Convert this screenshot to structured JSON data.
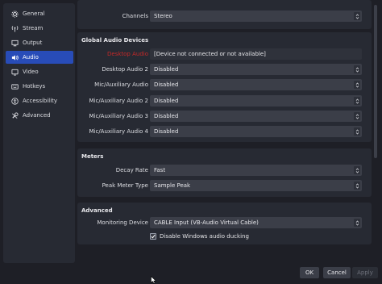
{
  "sidebar": {
    "items": [
      {
        "label": "General",
        "icon": "gear-icon",
        "active": false
      },
      {
        "label": "Stream",
        "icon": "antenna-icon",
        "active": false
      },
      {
        "label": "Output",
        "icon": "output-icon",
        "active": false
      },
      {
        "label": "Audio",
        "icon": "speaker-icon",
        "active": true
      },
      {
        "label": "Video",
        "icon": "monitor-icon",
        "active": false
      },
      {
        "label": "Hotkeys",
        "icon": "keyboard-icon",
        "active": false
      },
      {
        "label": "Accessibility",
        "icon": "accessibility-icon",
        "active": false
      },
      {
        "label": "Advanced",
        "icon": "wrench-icon",
        "active": false
      }
    ]
  },
  "top": {
    "channels_label": "Channels",
    "channels_value": "Stereo"
  },
  "global_audio": {
    "title": "Global Audio Devices",
    "rows": [
      {
        "label": "Desktop Audio",
        "value": "[Device not connected or not available]",
        "warn": true
      },
      {
        "label": "Desktop Audio 2",
        "value": "Disabled",
        "warn": false
      },
      {
        "label": "Mic/Auxiliary Audio",
        "value": "Disabled",
        "warn": false
      },
      {
        "label": "Mic/Auxiliary Audio 2",
        "value": "Disabled",
        "warn": false
      },
      {
        "label": "Mic/Auxiliary Audio 3",
        "value": "Disabled",
        "warn": false
      },
      {
        "label": "Mic/Auxiliary Audio 4",
        "value": "Disabled",
        "warn": false
      }
    ]
  },
  "meters": {
    "title": "Meters",
    "rows": [
      {
        "label": "Decay Rate",
        "value": "Fast"
      },
      {
        "label": "Peak Meter Type",
        "value": "Sample Peak"
      }
    ]
  },
  "advanced": {
    "title": "Advanced",
    "monitoring_label": "Monitoring Device",
    "monitoring_value": "CABLE Input (VB-Audio Virtual Cable)",
    "ducking_label": "Disable Windows audio ducking",
    "ducking_checked": true
  },
  "buttons": {
    "ok": "OK",
    "cancel": "Cancel",
    "apply": "Apply"
  },
  "colors": {
    "accent": "#284cb8",
    "warning_text": "#c62828",
    "background": "#1e1f26",
    "panel": "#272a33"
  }
}
